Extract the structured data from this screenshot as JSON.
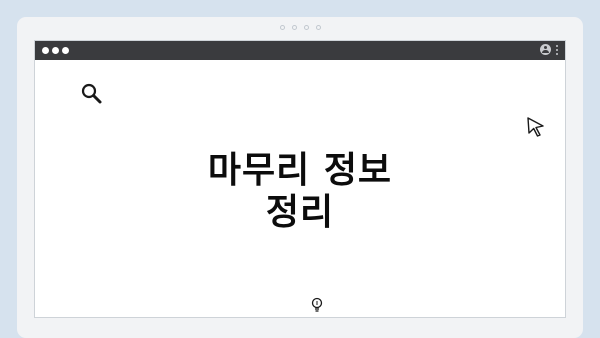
{
  "slide": {
    "headline_line1": "마무리 정보",
    "headline_line2": "정리"
  },
  "pager": {
    "count": 4
  },
  "icons": {
    "search": "search-icon",
    "cursor": "cursor-icon",
    "bulb": "lightbulb-icon",
    "user": "user-icon",
    "menu": "kebab-menu-icon"
  },
  "colors": {
    "page_background": "#d6e2ee",
    "title_bar": "#3a3b3e",
    "window": "#ffffff",
    "text": "#0c0c0c"
  }
}
